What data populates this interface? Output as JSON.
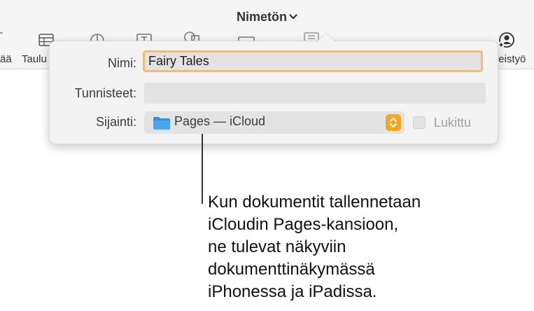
{
  "window": {
    "title": "Nimetön"
  },
  "toolbar": {
    "items": [
      {
        "label": "ää",
        "icon": "partial-icon"
      },
      {
        "label": "Taulu",
        "icon": "table-icon"
      },
      {
        "label": "",
        "icon": "chart-icon"
      },
      {
        "label": "",
        "icon": "text-icon"
      },
      {
        "label": "",
        "icon": "shape-icon"
      },
      {
        "label": "",
        "icon": "media-icon"
      },
      {
        "label": "",
        "icon": "comment-icon"
      },
      {
        "label": "teistyö",
        "icon": "collaborate-icon"
      }
    ]
  },
  "dialog": {
    "name_label": "Nimi:",
    "name_value": "Fairy Tales",
    "tags_label": "Tunnisteet:",
    "tags_value": "",
    "location_label": "Sijainti:",
    "location_value": "Pages — iCloud",
    "locked_label": "Lukittu",
    "locked_checked": false
  },
  "callout": {
    "lines": [
      "Kun dokumentit tallennetaan",
      "iCloudin Pages-kansioon,",
      "ne tulevat näkyviin",
      "dokumenttinäkymässä",
      "iPhonessa ja iPadissa."
    ]
  },
  "colors": {
    "accent": "#f5a623",
    "focus_ring": "#f0bb7a",
    "folder": "#2f8fe3"
  }
}
